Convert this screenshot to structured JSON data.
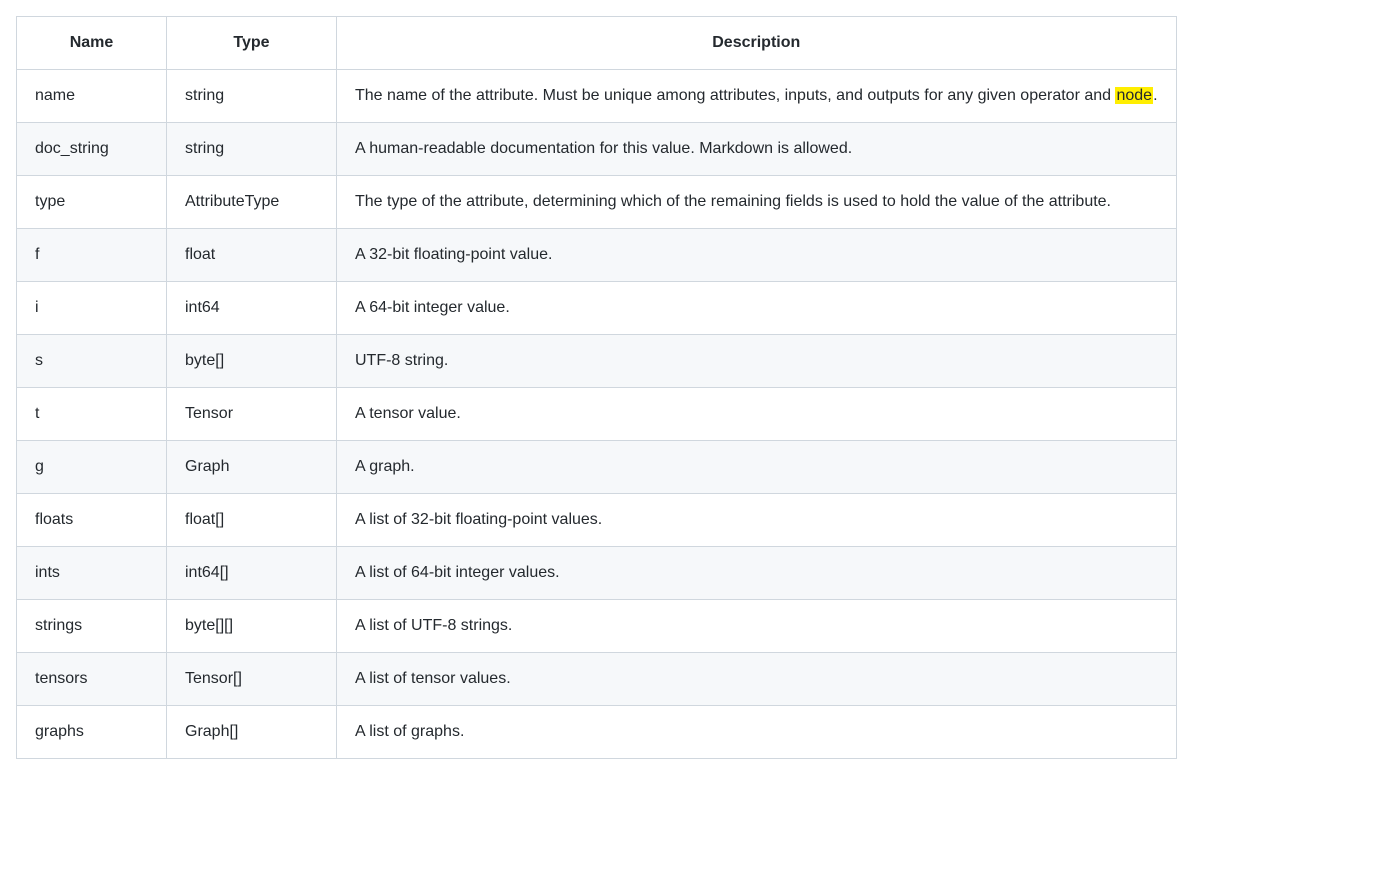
{
  "table": {
    "headers": {
      "name": "Name",
      "type": "Type",
      "description": "Description"
    },
    "rows": [
      {
        "name": "name",
        "type": "string",
        "desc_before": "The name of the attribute. Must be unique among attributes, inputs, and outputs for any given operator and ",
        "desc_highlight": "node",
        "desc_after": "."
      },
      {
        "name": "doc_string",
        "type": "string",
        "desc": "A human-readable documentation for this value. Markdown is allowed."
      },
      {
        "name": "type",
        "type": "AttributeType",
        "desc": "The type of the attribute, determining which of the remaining fields is used to hold the value of the attribute."
      },
      {
        "name": "f",
        "type": "float",
        "desc": "A 32-bit floating-point value."
      },
      {
        "name": "i",
        "type": "int64",
        "desc": "A 64-bit integer value."
      },
      {
        "name": "s",
        "type": "byte[]",
        "desc": "UTF-8 string."
      },
      {
        "name": "t",
        "type": "Tensor",
        "desc": "A tensor value."
      },
      {
        "name": "g",
        "type": "Graph",
        "desc": "A graph."
      },
      {
        "name": "floats",
        "type": "float[]",
        "desc": "A list of 32-bit floating-point values."
      },
      {
        "name": "ints",
        "type": "int64[]",
        "desc": "A list of 64-bit integer values."
      },
      {
        "name": "strings",
        "type": "byte[][]",
        "desc": "A list of UTF-8 strings."
      },
      {
        "name": "tensors",
        "type": "Tensor[]",
        "desc": "A list of tensor values."
      },
      {
        "name": "graphs",
        "type": "Graph[]",
        "desc": "A list of graphs."
      }
    ]
  }
}
